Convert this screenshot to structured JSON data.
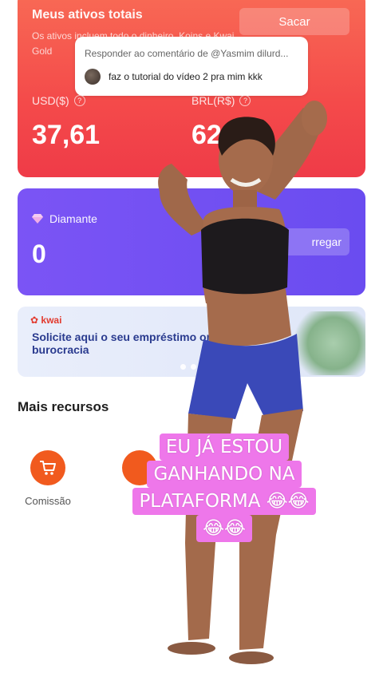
{
  "assets": {
    "title": "Meus ativos totais",
    "description": "Os ativos incluem todo o dinheiro, Koins e Kwai Gold",
    "withdraw_label": "Sacar",
    "usd_label": "USD($)",
    "usd_value": "37,61",
    "brl_label": "BRL(R$)",
    "brl_value": "62,",
    "help_glyph": "?"
  },
  "diamond": {
    "label": "Diamante",
    "value": "0",
    "recharge_label": "rregar"
  },
  "banner": {
    "logo": "kwai",
    "text": "Solicite aqui o seu empréstimo online sem burocracia"
  },
  "more_features": {
    "title": "Mais recursos",
    "items": [
      {
        "label": "Comissão",
        "icon": "cart-icon"
      },
      {
        "label": "",
        "icon": "feature-icon"
      }
    ]
  },
  "comment": {
    "header": "Responder ao comentário de @Yasmim dilurd...",
    "text": "faz o tutorial do vídeo 2 pra mim kkk"
  },
  "caption": {
    "lines": [
      "EU JÁ ESTOU",
      "GANHANDO NA",
      "PLATAFORMA 😂😂",
      "😂😂"
    ]
  },
  "colors": {
    "assets_card": "#f44a4a",
    "diamond_card": "#6a4cf0",
    "caption_bg": "#ee77ea",
    "feature_icon": "#f15a1e"
  }
}
